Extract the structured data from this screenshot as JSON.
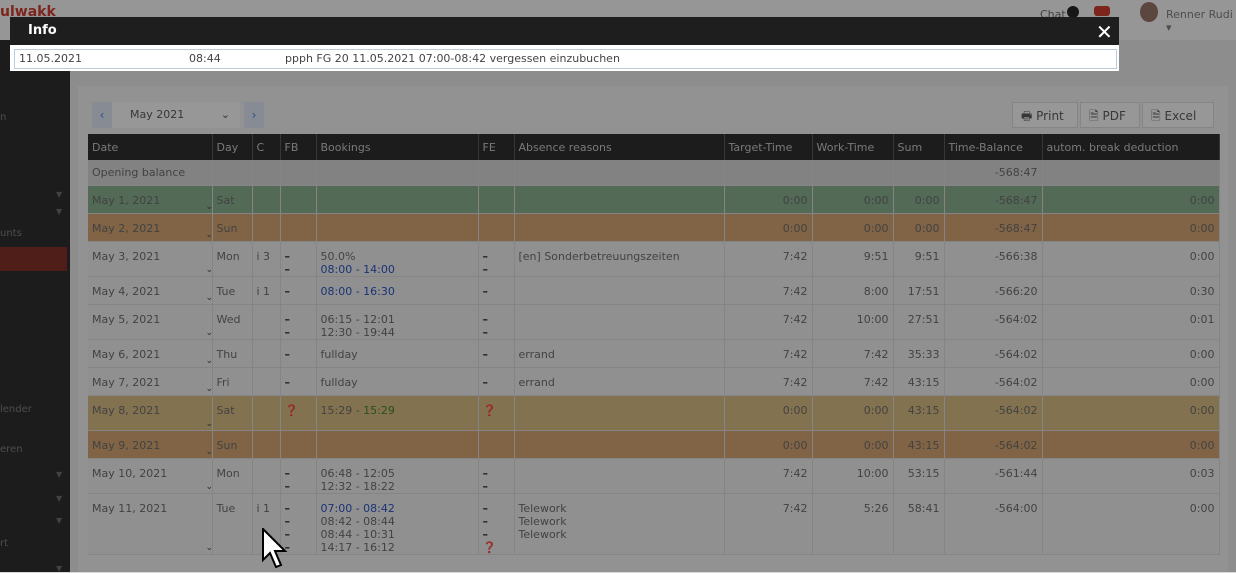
{
  "app": {
    "brand": "ulwakk",
    "chat": "Chat",
    "user": "Renner Rudi ▾"
  },
  "sidebar": {
    "items": [
      "n",
      "unts",
      "lender",
      "eren",
      "rt"
    ]
  },
  "toolbar": {
    "prev": "‹",
    "next": "›",
    "month": "May 2021",
    "print": "Print",
    "pdf": "PDF",
    "excel": "Excel"
  },
  "table": {
    "headers": [
      "Date",
      "Day",
      "C",
      "FB",
      "Bookings",
      "FE",
      "Absence reasons",
      "Target-Time",
      "Work-Time",
      "Sum",
      "Time-Balance",
      "autom. break deduction"
    ],
    "opening": {
      "label": "Opening balance",
      "balance": "-568:47"
    },
    "rows": [
      {
        "date": "May 1, 2021",
        "day": "Sat",
        "c": "",
        "fb": "",
        "bookings": [],
        "fe": "",
        "absence": "",
        "target": "0:00",
        "work": "0:00",
        "sum": "0:00",
        "balance": "-568:47",
        "brk": "0:00",
        "tone": "green"
      },
      {
        "date": "May 2, 2021",
        "day": "Sun",
        "c": "",
        "fb": "",
        "bookings": [],
        "fe": "",
        "absence": "",
        "target": "0:00",
        "work": "0:00",
        "sum": "0:00",
        "balance": "-568:47",
        "brk": "0:00",
        "tone": "orange"
      },
      {
        "date": "May 3, 2021",
        "day": "Mon",
        "c": "i 3",
        "fb": "–\n–",
        "bookings": [
          {
            "text": "50.0%",
            "cls": ""
          },
          {
            "text": "08:00 - 14:00",
            "cls": "blue"
          }
        ],
        "fe": "–\n–",
        "absence": "[en] Sonderbetreuungszeiten",
        "target": "7:42",
        "work": "9:51",
        "sum": "9:51",
        "balance": "-566:38",
        "brk": "0:00",
        "tone": "normal"
      },
      {
        "date": "May 4, 2021",
        "day": "Tue",
        "c": "i 1",
        "fb": "–",
        "bookings": [
          {
            "text": "08:00 - 16:30",
            "cls": "blue"
          }
        ],
        "fe": "–",
        "absence": "",
        "target": "7:42",
        "work": "8:00",
        "sum": "17:51",
        "balance": "-566:20",
        "brk": "0:30",
        "tone": "normal"
      },
      {
        "date": "May 5, 2021",
        "day": "Wed",
        "c": "",
        "fb": "–\n–",
        "bookings": [
          {
            "text": "06:15 - 12:01",
            "cls": ""
          },
          {
            "text": "12:30 - 19:44",
            "cls": ""
          }
        ],
        "fe": "–\n–",
        "absence": "",
        "target": "7:42",
        "work": "10:00",
        "sum": "27:51",
        "balance": "-564:02",
        "brk": "0:01",
        "tone": "normal"
      },
      {
        "date": "May 6, 2021",
        "day": "Thu",
        "c": "",
        "fb": "–",
        "bookings": [
          {
            "text": "fullday",
            "cls": ""
          }
        ],
        "fe": "–",
        "absence": "errand",
        "target": "7:42",
        "work": "7:42",
        "sum": "35:33",
        "balance": "-564:02",
        "brk": "0:00",
        "tone": "normal"
      },
      {
        "date": "May 7, 2021",
        "day": "Fri",
        "c": "",
        "fb": "–",
        "bookings": [
          {
            "text": "fullday",
            "cls": ""
          }
        ],
        "fe": "–",
        "absence": "errand",
        "target": "7:42",
        "work": "7:42",
        "sum": "43:15",
        "balance": "-564:02",
        "brk": "0:00",
        "tone": "normal"
      },
      {
        "date": "May 8, 2021",
        "day": "Sat",
        "c": "",
        "fb": "❓",
        "bookings": [
          {
            "text": "15:29 - ",
            "cls": ""
          },
          {
            "text": "15:29",
            "cls": "grn",
            "inline": true
          }
        ],
        "fe": "❓",
        "absence": "",
        "target": "0:00",
        "work": "0:00",
        "sum": "43:15",
        "balance": "-564:02",
        "brk": "0:00",
        "tone": "yellow"
      },
      {
        "date": "May 9, 2021",
        "day": "Sun",
        "c": "",
        "fb": "",
        "bookings": [],
        "fe": "",
        "absence": "",
        "target": "0:00",
        "work": "0:00",
        "sum": "43:15",
        "balance": "-564:02",
        "brk": "0:00",
        "tone": "orange"
      },
      {
        "date": "May 10, 2021",
        "day": "Mon",
        "c": "",
        "fb": "–\n–",
        "bookings": [
          {
            "text": "06:48 - 12:05",
            "cls": ""
          },
          {
            "text": "12:32 - 18:22",
            "cls": ""
          }
        ],
        "fe": "–\n–",
        "absence": "",
        "target": "7:42",
        "work": "10:00",
        "sum": "53:15",
        "balance": "-561:44",
        "brk": "0:03",
        "tone": "normal"
      },
      {
        "date": "May 11, 2021",
        "day": "Tue",
        "c": "i 1",
        "fb": "–\n–\n–\n–",
        "bookings": [
          {
            "text": "07:00 - 08:42",
            "cls": "blue"
          },
          {
            "text": "08:42 - 08:44",
            "cls": ""
          },
          {
            "text": "08:44 - 10:31",
            "cls": ""
          },
          {
            "text": "14:17 - 16:12",
            "cls": ""
          }
        ],
        "fe": "–\n–\n–\n❓",
        "absence": "Telework\nTelework\nTelework",
        "target": "7:42",
        "work": "5:26",
        "sum": "58:41",
        "balance": "-564:00",
        "brk": "0:00",
        "tone": "normal"
      }
    ]
  },
  "modal": {
    "title": "Info",
    "close": "✕",
    "row": {
      "date": "11.05.2021",
      "time": "08:44",
      "text": "ppph FG 20 11.05.2021 07:00-08:42 vergessen einzubuchen"
    }
  },
  "colors": {
    "blue": "#2a4fb5",
    "green": "#3d7a2e",
    "weekend_green": "#7fa384",
    "weekend_orange": "#c69a6a"
  }
}
